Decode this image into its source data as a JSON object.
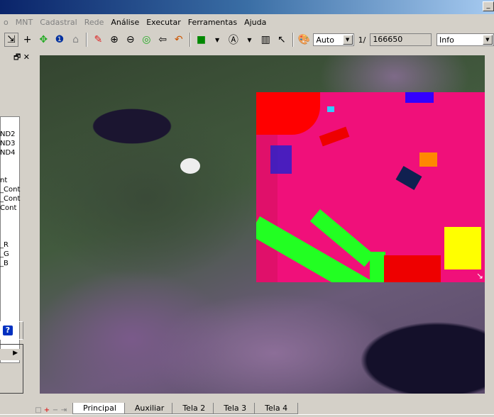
{
  "menu": {
    "items": [
      {
        "label": "o",
        "enabled": false
      },
      {
        "label": "MNT",
        "enabled": false
      },
      {
        "label": "Cadastral",
        "enabled": false
      },
      {
        "label": "Rede",
        "enabled": false
      },
      {
        "label": "Análise",
        "enabled": true
      },
      {
        "label": "Executar",
        "enabled": true
      },
      {
        "label": "Ferramentas",
        "enabled": true
      },
      {
        "label": "Ajuda",
        "enabled": true
      }
    ]
  },
  "toolbar": {
    "scale_mode": "Auto",
    "scale_prefix": "1/",
    "scale_value": "166650",
    "info_mode": "Info"
  },
  "panel": {
    "layers": [
      "ND2",
      "ND3",
      "ND4",
      "",
      "nt",
      "_Cont",
      "_Cont",
      "Cont",
      "",
      "",
      "",
      "_R",
      "_G",
      "_B"
    ],
    "help": "?"
  },
  "tabs": {
    "items": [
      "Principal",
      "Auxiliar",
      "Tela 2",
      "Tela 3",
      "Tela 4"
    ],
    "active": "Principal"
  },
  "colors": {
    "classification_background": "#f0107a",
    "accent": "#0a246a"
  }
}
